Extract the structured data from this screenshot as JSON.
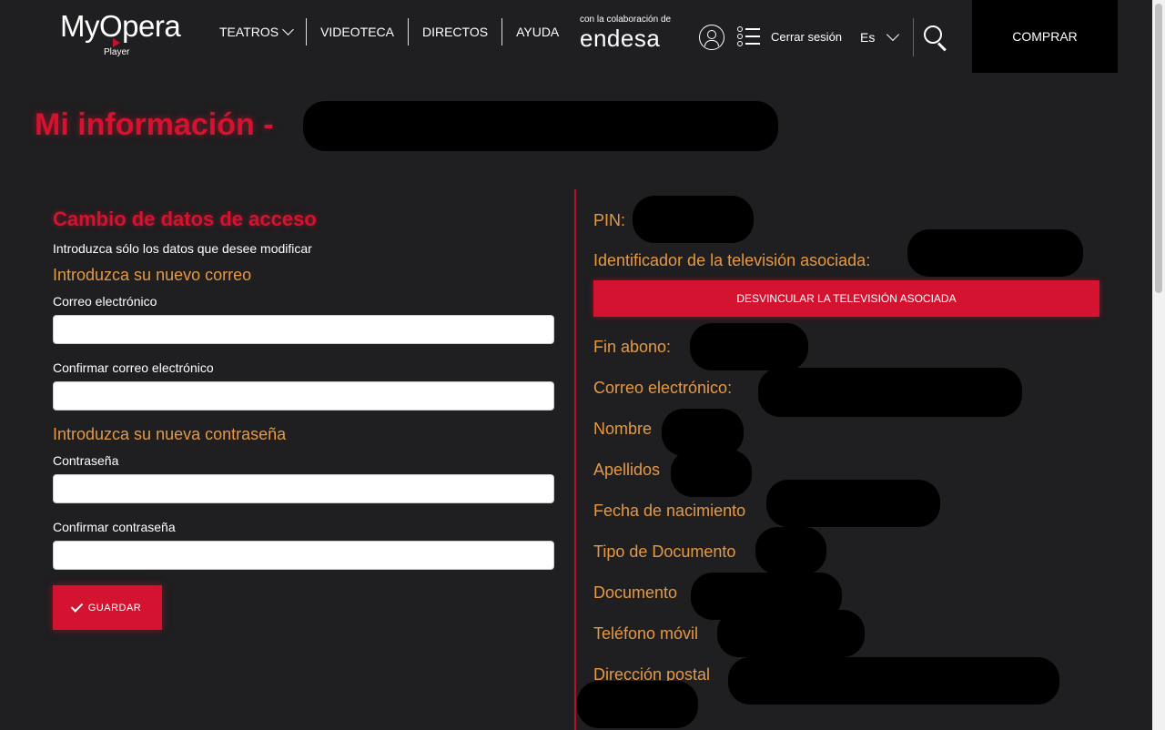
{
  "header": {
    "logo_text": "MyOpera",
    "logo_sub": "Player",
    "nav": [
      "TEATROS",
      "VIDEOTECA",
      "DIRECTOS",
      "AYUDA"
    ],
    "sponsor_pre": "con la colaboración de",
    "sponsor_name": "endesa",
    "logout": "Cerrar sesión",
    "lang": "Es",
    "buy": "COMPRAR"
  },
  "page": {
    "title": "Mi información -"
  },
  "form": {
    "section_title": "Cambio de datos de acceso",
    "intro": "Introduzca sólo los datos que desee modificar",
    "email_heading": "Introduzca su nuevo correo",
    "email_label": "Correo electrónico",
    "email_confirm_label": "Confirmar correo electrónico",
    "password_heading": "Introduzca su nueva contraseña",
    "password_label": "Contraseña",
    "password_confirm_label": "Confirmar contraseña",
    "save": "GUARDAR"
  },
  "info": {
    "pin": "PIN:",
    "tv_id": "Identificador de la televisión asociada:",
    "unlink": "DESVINCULAR LA TELEVISIÓN ASOCIADA",
    "end_sub": "Fin abono:",
    "email": "Correo electrónico:",
    "name": "Nombre",
    "surname": "Apellidos",
    "birth": "Fecha de nacimiento",
    "doc_type": "Tipo de Documento",
    "doc": "Documento",
    "phone": "Teléfono móvil",
    "address": "Dirección postal"
  },
  "colors": {
    "accent": "#d3132f",
    "label_orange": "#e59944",
    "background": "#1f1e20"
  }
}
